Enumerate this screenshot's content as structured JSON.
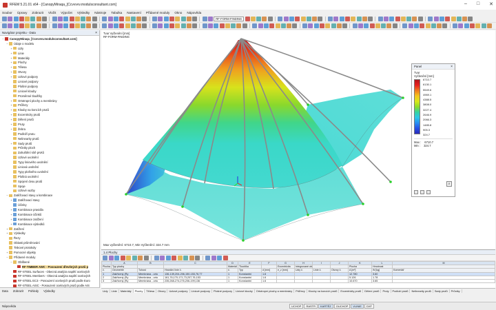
{
  "window": {
    "title": "RFEM 5.21.01 x64 - [CanopyMiraqa_[Ccvvvvv.modulsconsultant.com]",
    "controls": [
      "–",
      "□",
      "✕"
    ]
  },
  "menu": [
    "Soubor",
    "Úpravy",
    "Zobrazit",
    "Vložit",
    "Výpočet",
    "Výsledky",
    "Nástroje",
    "Tabulka",
    "Nastavení",
    "Přídavné moduly",
    "Okno",
    "Nápověda"
  ],
  "toolbar": {
    "combo_label": "RF-FORM-FINDING"
  },
  "navigator": {
    "title": "Navigátor projektu - Data",
    "items": [
      {
        "level": 0,
        "exp": "−",
        "label": "CanopyMiraqa_[Ccvvvvv.modulsconsultant.com]",
        "icon": "#c8362d",
        "bold": true
      },
      {
        "level": 1,
        "exp": "−",
        "label": "Údaje o modelu",
        "icon": "#e8c060"
      },
      {
        "level": 2,
        "exp": "+",
        "label": "Uzly",
        "icon": "#e8c060"
      },
      {
        "level": 2,
        "exp": "+",
        "label": "Linie",
        "icon": "#e8c060"
      },
      {
        "level": 2,
        "exp": "+",
        "label": "Materiály",
        "icon": "#e8c060"
      },
      {
        "level": 2,
        "exp": "+",
        "label": "Plochy",
        "icon": "#e8c060"
      },
      {
        "level": 2,
        "exp": "+",
        "label": "Tělesa",
        "icon": "#e8c060"
      },
      {
        "level": 2,
        "exp": "+",
        "label": "Otvory",
        "icon": "#e8c060"
      },
      {
        "level": 2,
        "exp": "+",
        "label": "Uzlové podpory",
        "icon": "#e8c060"
      },
      {
        "level": 2,
        "exp": "",
        "label": "Liniové podpory",
        "icon": "#e8c060"
      },
      {
        "level": 2,
        "exp": "",
        "label": "Plošné podpory",
        "icon": "#e8c060"
      },
      {
        "level": 2,
        "exp": "",
        "label": "Liniové klouby",
        "icon": "#e8c060"
      },
      {
        "level": 2,
        "exp": "",
        "label": "Proměnné tloušťky",
        "icon": "#e8c060"
      },
      {
        "level": 2,
        "exp": "+",
        "label": "Ortotropní plochy a membrány",
        "icon": "#e8c060"
      },
      {
        "level": 2,
        "exp": "+",
        "label": "Průřezy",
        "icon": "#e8c060"
      },
      {
        "level": 2,
        "exp": "+",
        "label": "Klouby na koncích prutů",
        "icon": "#e8c060"
      },
      {
        "level": 2,
        "exp": "+",
        "label": "Excentricity prutů",
        "icon": "#e8c060"
      },
      {
        "level": 2,
        "exp": "+",
        "label": "Dělení prutů",
        "icon": "#e8c060"
      },
      {
        "level": 2,
        "exp": "+",
        "label": "Pruty",
        "icon": "#e8c060"
      },
      {
        "level": 2,
        "exp": "+",
        "label": "Žebra",
        "icon": "#e8c060"
      },
      {
        "level": 2,
        "exp": "",
        "label": "Podloží prutu",
        "icon": "#e8c060"
      },
      {
        "level": 2,
        "exp": "",
        "label": "Nelinearity prutů",
        "icon": "#e8c060"
      },
      {
        "level": 2,
        "exp": "+",
        "label": "Sady prutů",
        "icon": "#e8c060"
      },
      {
        "level": 2,
        "exp": "",
        "label": "Průniky ploch",
        "icon": "#e8c060"
      },
      {
        "level": 2,
        "exp": "",
        "label": "Zahuštění sítě prvků",
        "icon": "#e8c060"
      },
      {
        "level": 2,
        "exp": "",
        "label": "Uzlové uvolnění",
        "icon": "#e8c060"
      },
      {
        "level": 2,
        "exp": "",
        "label": "Typy liniového uvolnění",
        "icon": "#e8c060"
      },
      {
        "level": 2,
        "exp": "",
        "label": "Liniová uvolnění",
        "icon": "#e8c060"
      },
      {
        "level": 2,
        "exp": "",
        "label": "Typy plošného uvolnění",
        "icon": "#e8c060"
      },
      {
        "level": 2,
        "exp": "",
        "label": "Plošná uvolnění",
        "icon": "#e8c060"
      },
      {
        "level": 2,
        "exp": "",
        "label": "Spojení dvou prutů",
        "icon": "#e8c060"
      },
      {
        "level": 2,
        "exp": "",
        "label": "Spoje",
        "icon": "#e8c060"
      },
      {
        "level": 2,
        "exp": "",
        "label": "Uzlové vazby",
        "icon": "#e8c060"
      },
      {
        "level": 1,
        "exp": "−",
        "label": "Zatěžovací stavy a kombinace",
        "icon": "#e8c060"
      },
      {
        "level": 2,
        "exp": "+",
        "label": "Zatěžovací stavy",
        "icon": "#6a9fd8"
      },
      {
        "level": 2,
        "exp": "",
        "label": "Účinky",
        "icon": "#6a9fd8"
      },
      {
        "level": 2,
        "exp": "+",
        "label": "Kombinace pravidla",
        "icon": "#6a9fd8"
      },
      {
        "level": 2,
        "exp": "+",
        "label": "Kombinace účinků",
        "icon": "#6a9fd8"
      },
      {
        "level": 2,
        "exp": "+",
        "label": "Kombinace zatížení",
        "icon": "#6a9fd8"
      },
      {
        "level": 2,
        "exp": "+",
        "label": "Kombinace výsledků",
        "icon": "#6a9fd8"
      },
      {
        "level": 1,
        "exp": "+",
        "label": "Zatížení",
        "icon": "#e8c060"
      },
      {
        "level": 1,
        "exp": "+",
        "label": "Výsledky",
        "icon": "#e8c060"
      },
      {
        "level": 1,
        "exp": "",
        "label": "Řezy",
        "icon": "#e8c060"
      },
      {
        "level": 1,
        "exp": "",
        "label": "Oblasti průměrování",
        "icon": "#e8c060"
      },
      {
        "level": 1,
        "exp": "",
        "label": "Tiskové protokoly",
        "icon": "#e8c060"
      },
      {
        "level": 1,
        "exp": "+",
        "label": "Pomocné objekty",
        "icon": "#e8c060"
      },
      {
        "level": 1,
        "exp": "−",
        "label": "Přídavné moduly",
        "icon": "#e8c060"
      },
      {
        "level": 2,
        "exp": "−",
        "label": "Oblíbené",
        "icon": "#e8c060"
      },
      {
        "level": 3,
        "exp": "",
        "label": "RF-TIMBER AWC - Posouzení dřevěných prutů p",
        "icon": "#c8362d",
        "bold": true,
        "selected": true
      },
      {
        "level": 2,
        "exp": "",
        "label": "RF-STEEL Surfaces - Obecná analýza napětí ocelových",
        "icon": "#c8362d"
      },
      {
        "level": 2,
        "exp": "",
        "label": "RF-STEEL Members - Obecná analýza napětí ocelových",
        "icon": "#c8362d"
      },
      {
        "level": 2,
        "exp": "",
        "label": "RF-STEEL EC3 - Posouzení ocelových prutů podle Euro",
        "icon": "#c8362d"
      },
      {
        "level": 2,
        "exp": "",
        "label": "RF-STEEL AISC - Posouzení ocelových prutů podle AIS",
        "icon": "#c8362d"
      },
      {
        "level": 2,
        "exp": "",
        "label": "RF-STEEL IS - Posouzení ocelových prutů podle IS",
        "icon": "#c8362d"
      }
    ],
    "tabs": [
      "Data",
      "Zobrazit",
      "Pohledy",
      "Výsledky"
    ]
  },
  "viewport": {
    "info_line1": "Tvar Vyčlenění [mm]",
    "info_line2": "RF-FORM-FINDING",
    "footer": "Max vyčlenění: 6710.7, Min Vyčlenění: 324.7 mm"
  },
  "panel": {
    "title": "Panel",
    "subtitle1": "Tvar",
    "subtitle2": "Vyčlenění [mm]",
    "legend_values": [
      "6710.7",
      "6130.1",
      "5549.6",
      "4969.1",
      "4388.5",
      "3808.0",
      "3227.4",
      "2646.9",
      "2066.3",
      "1485.8",
      "905.3",
      "324.7"
    ],
    "max_label": "Max :",
    "max_value": "6710.7",
    "min_label": "Min :",
    "min_value": "324.7"
  },
  "tables": {
    "title": "1.4 Plochy",
    "col_letters": [
      "",
      "A",
      "B",
      "C",
      "D",
      "E",
      "F",
      "G",
      "H",
      "I",
      "J",
      "K",
      "L",
      "M"
    ],
    "header1": [
      "Plocha",
      "Typ plochy",
      "",
      "",
      "Materiál",
      "Tloušťka",
      "",
      "Excentricita",
      "Integrované objekty",
      "",
      "",
      "Plocha",
      "Hmotnost",
      ""
    ],
    "header2": [
      "č.",
      "Geometrie",
      "Tuhost",
      "Hraniční linie č.",
      "č.",
      "Typ",
      "d [mm]",
      "e_z [mm]",
      "Uzly č.",
      "Linie č.",
      "Otvory č.",
      "A [m²]",
      "W [kg]",
      "Komentář"
    ],
    "rows": [
      [
        "1",
        "Zakřivený (Ry",
        "Membrána - orto",
        "136-139,204-206,150-153,76,77",
        "1",
        "Konstantní",
        "1.6",
        "",
        "",
        "",
        "",
        "12.780",
        "3.60",
        ""
      ],
      [
        "2",
        "Zakřivený (Ry",
        "Membrána - orto",
        "161,76,170-171,73,207,76,153",
        "1",
        "Konstantní",
        "1.6",
        "",
        "",
        "",
        "",
        "5.126",
        "1.78",
        ""
      ],
      [
        "3",
        "Zakřivený (Ry",
        "Membrána - orto",
        "235,268-274,276,206-199,136",
        "1",
        "Konstantní",
        "1.6",
        "",
        "",
        "",
        "",
        "10.670",
        "3.65",
        ""
      ]
    ],
    "tabs": [
      "Uzly",
      "Linie",
      "Materiály",
      "Plochy",
      "Tělesa",
      "Otvory",
      "Uzlové podpory",
      "Liniové podpory",
      "Plošné podpory",
      "Liniové klouby",
      "Ortotropní plochy a membrány",
      "Průřezy",
      "Klouby na koncích prutů",
      "Excentricity prutů",
      "Dělení prutů",
      "Pruty",
      "Podloží prutů",
      "Nelinearity prutů",
      "Sady prutů",
      "Průniky"
    ]
  },
  "status": {
    "message": "Nápověda",
    "modes": [
      "UCHOP",
      "RASTR",
      "KARTÉZ",
      "OUCHOP",
      "VLINIE",
      "DXF"
    ]
  },
  "colors": {
    "accent": "#c8362d",
    "selection": "#fbe3a3",
    "panel_header": "#e8eef6"
  }
}
